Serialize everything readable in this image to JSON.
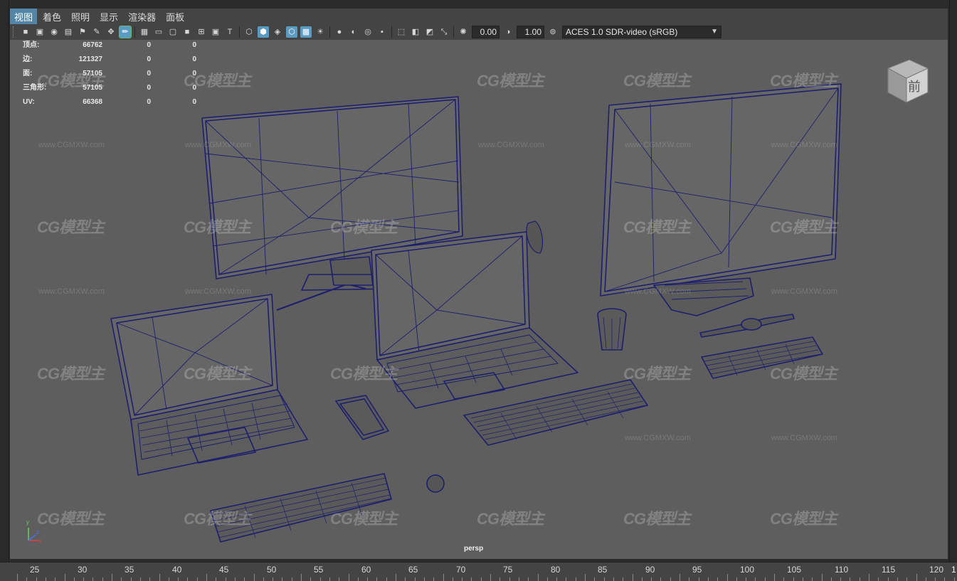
{
  "menu": {
    "items": [
      "视图",
      "着色",
      "照明",
      "显示",
      "渲染器",
      "面板"
    ]
  },
  "toolbar": {
    "exposure_value": "0.00",
    "gamma_value": "1.00",
    "colorspace_label": "ACES 1.0 SDR-video (sRGB)"
  },
  "hud": {
    "rows": [
      {
        "label": "顶点:",
        "v1": "66762",
        "v2": "0",
        "v3": "0"
      },
      {
        "label": "边:",
        "v1": "121327",
        "v2": "0",
        "v3": "0"
      },
      {
        "label": "面:",
        "v1": "57105",
        "v2": "0",
        "v3": "0"
      },
      {
        "label": "三角形:",
        "v1": "57105",
        "v2": "0",
        "v3": "0"
      },
      {
        "label": "UV:",
        "v1": "66368",
        "v2": "0",
        "v3": "0"
      }
    ]
  },
  "viewport": {
    "camera_name": "persp",
    "viewcube_face": "前",
    "watermark_logo": "CG模型主",
    "watermark_url": "www.CGMXW.com"
  },
  "axis": {
    "x": "x",
    "y": "y",
    "z": "z"
  },
  "timeline": {
    "ticks": [
      "25",
      "30",
      "35",
      "40",
      "45",
      "50",
      "55",
      "60",
      "65",
      "70",
      "75",
      "80",
      "85",
      "90",
      "95",
      "100",
      "105",
      "110",
      "115",
      "120"
    ],
    "right_marker": "1"
  },
  "colors": {
    "wireframe": "#1e1e6e",
    "viewport_bg": "#5e5e5e",
    "menu_active": "#5285a6",
    "tool_selected": "#5a9bc4"
  }
}
